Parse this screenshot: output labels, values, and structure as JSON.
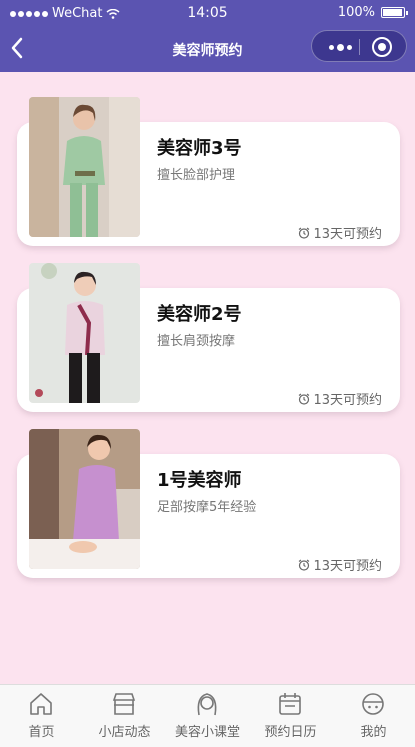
{
  "status_bar": {
    "carrier": "WeChat",
    "time": "14:05",
    "battery": "100%"
  },
  "nav": {
    "title": "美容师预约"
  },
  "cards": [
    {
      "name": "美容师3号",
      "desc": "擅长脸部护理",
      "availability": "13天可预约"
    },
    {
      "name": "美容师2号",
      "desc": "擅长肩颈按摩",
      "availability": "13天可预约"
    },
    {
      "name": "1号美容师",
      "desc": "足部按摩5年经验",
      "availability": "13天可预约"
    }
  ],
  "tabs": [
    {
      "label": "首页",
      "icon": "home-icon"
    },
    {
      "label": "小店动态",
      "icon": "shop-icon"
    },
    {
      "label": "美容小课堂",
      "icon": "lady-icon"
    },
    {
      "label": "预约日历",
      "icon": "calendar-icon"
    },
    {
      "label": "我的",
      "icon": "user-icon"
    }
  ],
  "colors": {
    "header": "#5b54b1",
    "background": "#fce3ef",
    "card": "#ffffff"
  }
}
